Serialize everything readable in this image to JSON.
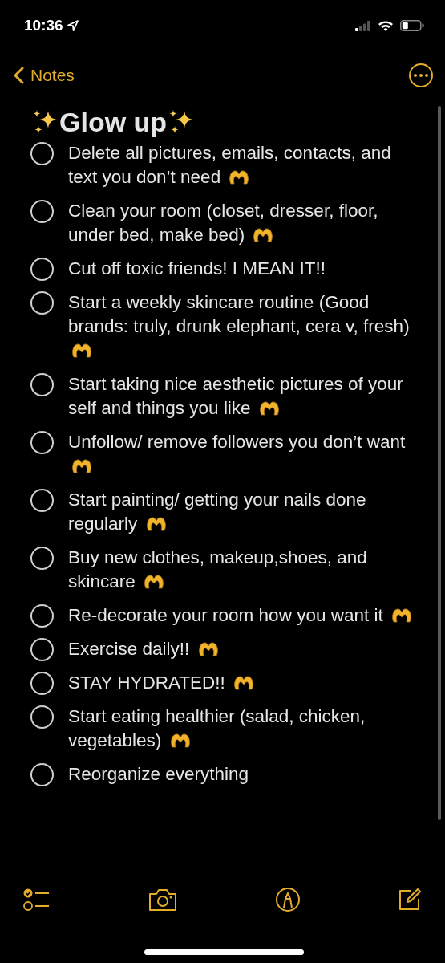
{
  "status_bar": {
    "time": "10:36",
    "location_on": true
  },
  "nav": {
    "back_label": "Notes"
  },
  "title": {
    "text": "Glow up",
    "sparkles": true
  },
  "checklist": [
    {
      "text": "Delete all pictures, emails, contacts, and text you don’t need",
      "checked": false,
      "heart_hands": true
    },
    {
      "text": "Clean your room (closet, dresser, floor, under bed, make bed)",
      "checked": false,
      "heart_hands": true
    },
    {
      "text": "Cut off toxic friends! I MEAN IT!!",
      "checked": false,
      "heart_hands": false
    },
    {
      "text": "Start a weekly skincare routine (Good brands: truly, drunk elephant, cera v, fresh)",
      "checked": false,
      "heart_hands": true
    },
    {
      "text": "Start taking nice aesthetic pictures of your self and things you like",
      "checked": false,
      "heart_hands": true
    },
    {
      "text": "Unfollow/ remove followers you don’t want",
      "checked": false,
      "heart_hands": true
    },
    {
      "text": "Start painting/ getting your nails done regularly",
      "checked": false,
      "heart_hands": true
    },
    {
      "text": "Buy new clothes, makeup,shoes, and skincare",
      "checked": false,
      "heart_hands": true
    },
    {
      "text": "Re-decorate your room how you want it",
      "checked": false,
      "heart_hands": true
    },
    {
      "text": "Exercise daily!!",
      "checked": false,
      "heart_hands": true
    },
    {
      "text": "STAY HYDRATED!!",
      "checked": false,
      "heart_hands": true
    },
    {
      "text": "Start eating healthier (salad, chicken, vegetables)",
      "checked": false,
      "heart_hands": true
    },
    {
      "text": "Reorganize everything",
      "checked": false,
      "heart_hands": false
    }
  ]
}
